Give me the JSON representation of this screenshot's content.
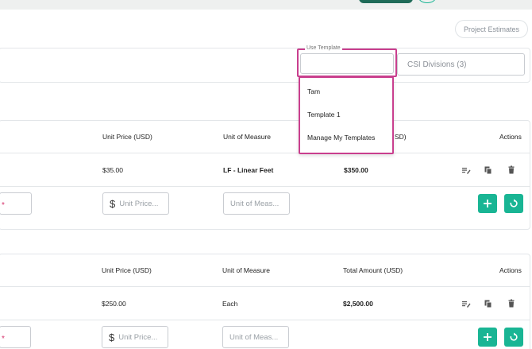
{
  "header": {
    "project_estimates_label": "Project Estimates"
  },
  "filters": {
    "use_template_label": "Use Template",
    "use_template_value": "",
    "csi_divisions_label": "CSI Divisions (3)"
  },
  "template_dropdown": {
    "options": [
      "Tam",
      "Template 1",
      "Manage My Templates"
    ]
  },
  "tables": [
    {
      "headers": {
        "unit_price": "Unit Price (USD)",
        "unit_of_measure": "Unit of Measure",
        "total_amount_partial": "SD)",
        "actions": "Actions"
      },
      "row": {
        "unit_price": "$35.00",
        "unit_of_measure": "LF - Linear Feet",
        "total_amount": "$350.00"
      },
      "input_row": {
        "required_marker": "*",
        "unit_price_symbol": "$",
        "unit_price_placeholder": "Unit Price...",
        "unit_of_measure_placeholder": "Unit of Meas..."
      }
    },
    {
      "headers": {
        "unit_price": "Unit Price (USD)",
        "unit_of_measure": "Unit of Measure",
        "total_amount": "Total Amount (USD)",
        "actions": "Actions"
      },
      "row": {
        "unit_price": "$250.00",
        "unit_of_measure": "Each",
        "total_amount": "$2,500.00"
      },
      "input_row": {
        "required_marker": "*",
        "unit_price_symbol": "$",
        "unit_price_placeholder": "Unit Price...",
        "unit_of_measure_placeholder": "Unit of Meas..."
      }
    }
  ],
  "icons": {
    "edit": "edit-list-icon",
    "copy": "copy-icon",
    "delete": "trash-icon",
    "add": "plus-icon",
    "reset": "reset-icon"
  },
  "colors": {
    "accent": "#19b594",
    "highlight": "#c93f8e",
    "dark_green": "#1f6b58"
  }
}
